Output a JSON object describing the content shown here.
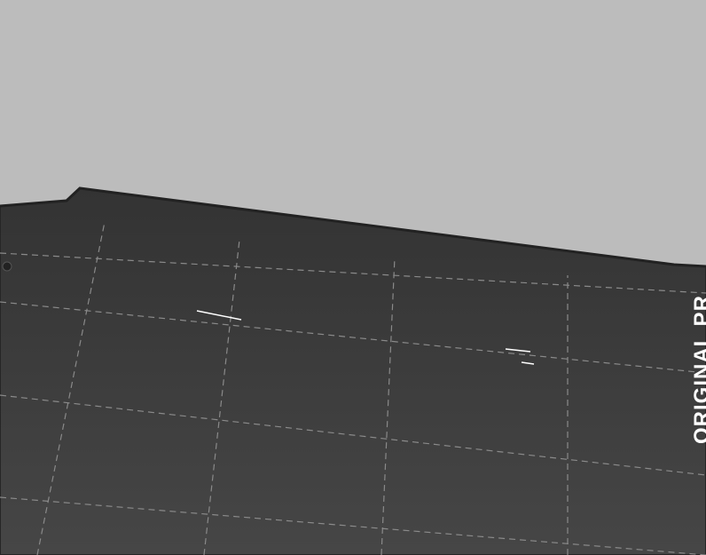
{
  "scene": {
    "bed_label": "ORIGINAL PR",
    "colors": {
      "background": "#bcbcbc",
      "bed": "#3a3a3a",
      "bed_edge": "#262626",
      "grid": "#8a8a8a",
      "model_green_top": "#00c000",
      "model_green_side": "#00a400",
      "model_green_inner": "#00b800",
      "brick": "#d06000",
      "brick_mortar": "#8a3c00",
      "selection_outline": "#ffffff"
    }
  }
}
